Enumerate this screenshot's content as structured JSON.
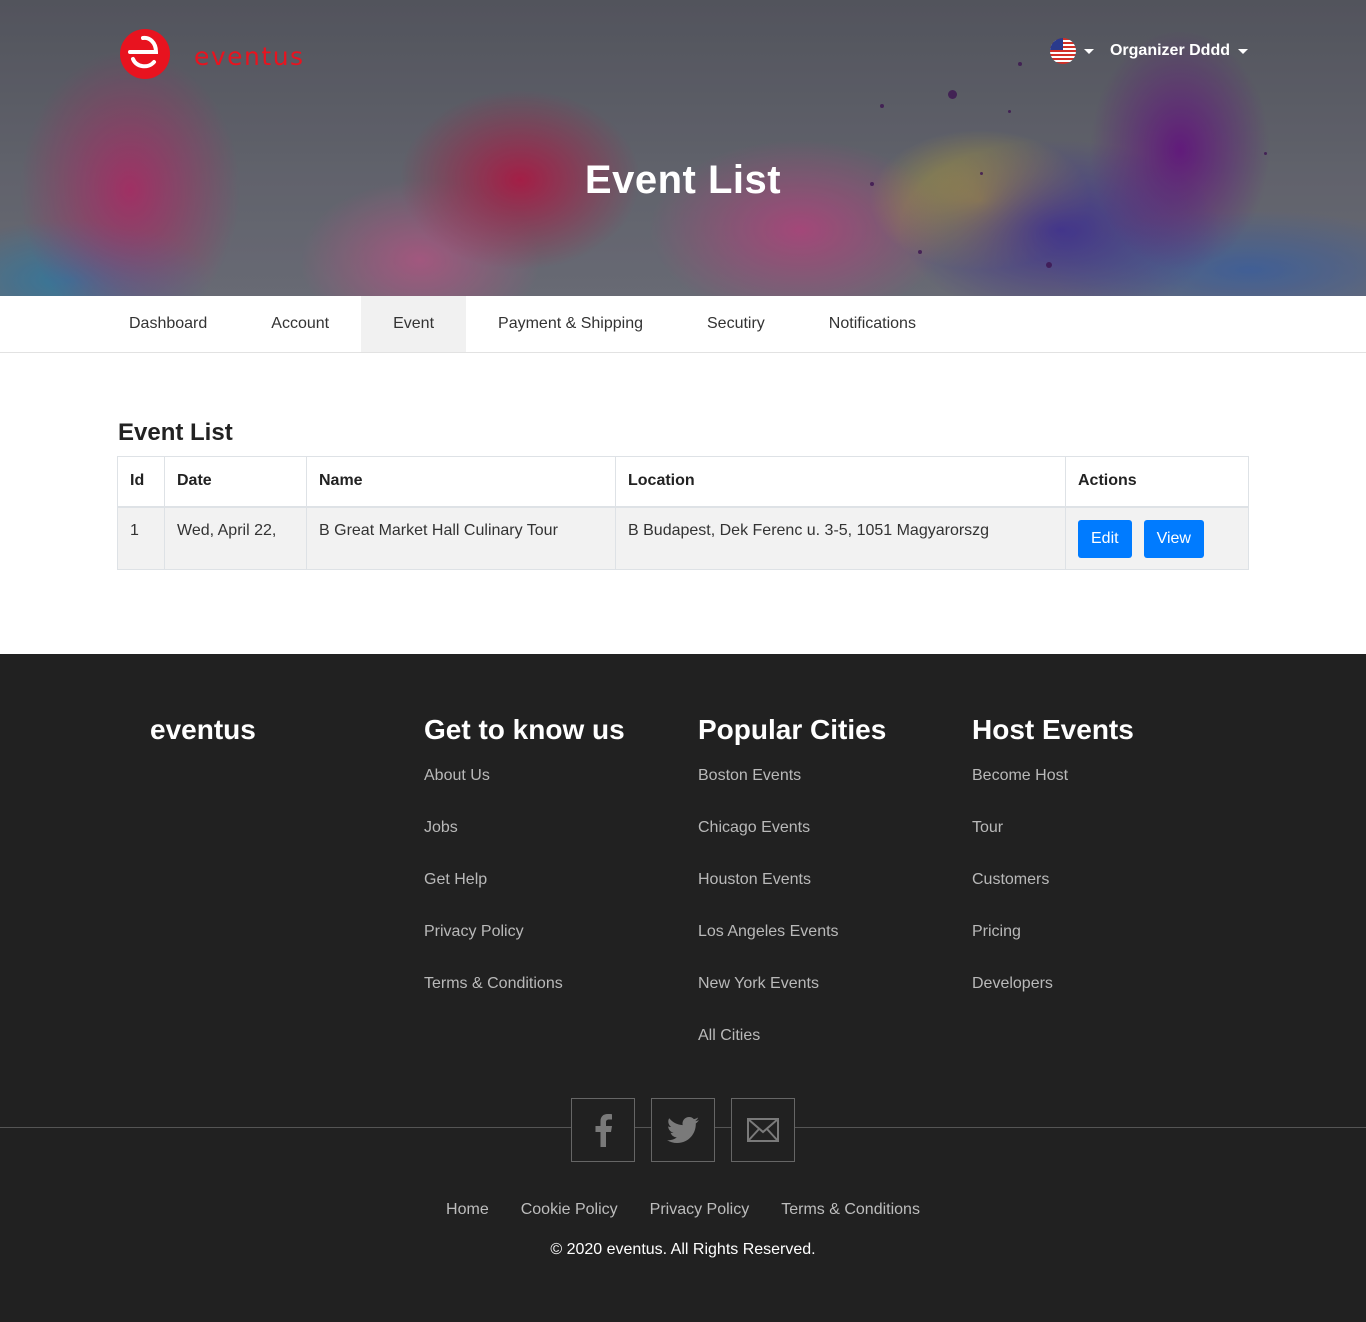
{
  "brand": {
    "name": "eventus",
    "color": "#e8131f"
  },
  "header": {
    "language_icon": "us-flag-icon",
    "user_name": "Organizer Dddd",
    "hero_title": "Event List"
  },
  "tabs": [
    {
      "label": "Dashboard",
      "active": false
    },
    {
      "label": "Account",
      "active": false
    },
    {
      "label": "Event",
      "active": true
    },
    {
      "label": "Payment & Shipping",
      "active": false
    },
    {
      "label": "Secutiry",
      "active": false
    },
    {
      "label": "Notifications",
      "active": false
    }
  ],
  "main": {
    "section_title": "Event List",
    "table": {
      "headers": {
        "id": "Id",
        "date": "Date",
        "name": "Name",
        "location": "Location",
        "actions": "Actions"
      },
      "rows": [
        {
          "id": "1",
          "date": "Wed, April 22,",
          "name": "B Great Market Hall Culinary Tour",
          "location": "B Budapest, Dek Ferenc u. 3-5, 1051 Magyarorszg",
          "edit_label": "Edit",
          "view_label": "View"
        }
      ]
    },
    "accent_color": "#007bff"
  },
  "footer": {
    "brand": "eventus",
    "columns": [
      {
        "heading": "Get to know us",
        "links": [
          "About Us",
          "Jobs",
          "Get Help",
          "Privacy Policy",
          "Terms & Conditions"
        ]
      },
      {
        "heading": "Popular Cities",
        "links": [
          "Boston Events",
          "Chicago Events",
          "Houston Events",
          "Los Angeles Events",
          "New York Events",
          "All Cities"
        ]
      },
      {
        "heading": "Host Events",
        "links": [
          "Become Host",
          "Tour",
          "Customers",
          "Pricing",
          "Developers"
        ]
      }
    ],
    "social_icons": [
      "facebook-icon",
      "twitter-icon",
      "email-icon"
    ],
    "bottom_links": [
      "Home",
      "Cookie Policy",
      "Privacy Policy",
      "Terms & Conditions"
    ],
    "copyright": "© 2020 eventus. All Rights Reserved."
  }
}
